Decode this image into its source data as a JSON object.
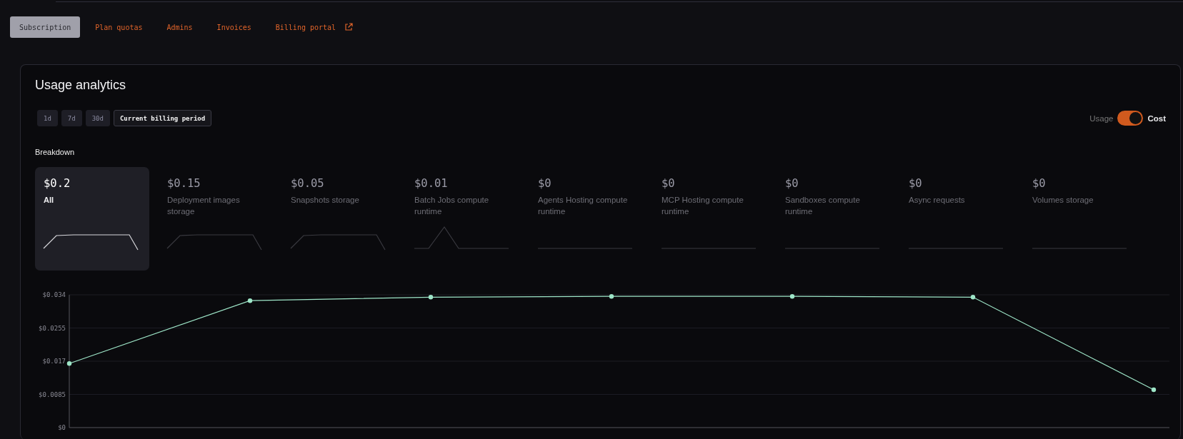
{
  "tabs": [
    {
      "label": "Subscription",
      "selected": true,
      "external": false
    },
    {
      "label": "Plan quotas",
      "selected": false,
      "external": false
    },
    {
      "label": "Admins",
      "selected": false,
      "external": false
    },
    {
      "label": "Invoices",
      "selected": false,
      "external": false
    },
    {
      "label": "Billing portal",
      "selected": false,
      "external": true
    }
  ],
  "usage_analytics": {
    "title": "Usage analytics",
    "ranges": [
      {
        "label": "1d",
        "selected": false
      },
      {
        "label": "7d",
        "selected": false
      },
      {
        "label": "30d",
        "selected": false
      },
      {
        "label": "Current billing period",
        "selected": true
      }
    ],
    "toggle": {
      "off_label": "Usage",
      "on_label": "Cost",
      "on": true
    },
    "breakdown_title": "Breakdown",
    "breakdown": [
      {
        "value": "$0.2",
        "label": "All",
        "selected": true,
        "kind": "plateau"
      },
      {
        "value": "$0.15",
        "label": "Deployment images storage",
        "selected": false,
        "kind": "plateau"
      },
      {
        "value": "$0.05",
        "label": "Snapshots storage",
        "selected": false,
        "kind": "plateau"
      },
      {
        "value": "$0.01",
        "label": "Batch Jobs compute runtime",
        "selected": false,
        "kind": "spike"
      },
      {
        "value": "$0",
        "label": "Agents Hosting compute runtime",
        "selected": false,
        "kind": "flat"
      },
      {
        "value": "$0",
        "label": "MCP Hosting compute runtime",
        "selected": false,
        "kind": "flat"
      },
      {
        "value": "$0",
        "label": "Sandboxes compute runtime",
        "selected": false,
        "kind": "flat"
      },
      {
        "value": "$0",
        "label": "Async requests",
        "selected": false,
        "kind": "flat"
      },
      {
        "value": "$0",
        "label": "Volumes storage",
        "selected": false,
        "kind": "flat"
      }
    ],
    "chart_data": {
      "type": "line",
      "ylim": [
        0,
        0.034
      ],
      "grid": true,
      "yticks": [
        {
          "value": 0,
          "label": "$0"
        },
        {
          "value": 0.0085,
          "label": "$0.0085"
        },
        {
          "value": 0.017,
          "label": "$0.017"
        },
        {
          "value": 0.0255,
          "label": "$0.0255"
        },
        {
          "value": 0.034,
          "label": "$0.034"
        }
      ],
      "series": [
        {
          "color": "#9ee6c8",
          "marker": "circle",
          "values": [
            0.0164,
            0.0325,
            0.0334,
            0.0336,
            0.0336,
            0.0334,
            0.0097
          ]
        }
      ]
    }
  }
}
